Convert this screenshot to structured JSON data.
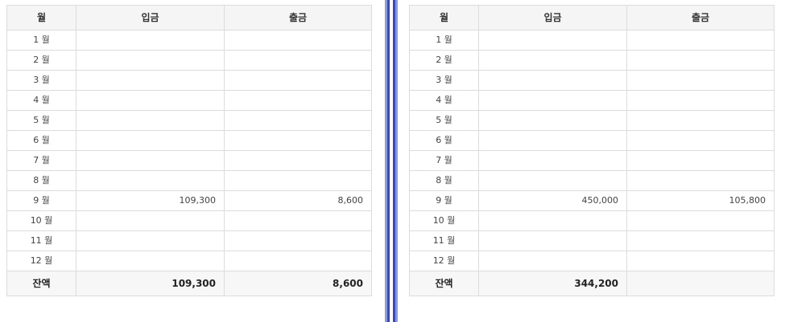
{
  "tables": [
    {
      "headers": [
        "월",
        "입금",
        "출금"
      ],
      "rows": [
        {
          "month": "1 월",
          "deposit": "",
          "withdrawal": ""
        },
        {
          "month": "2 월",
          "deposit": "",
          "withdrawal": ""
        },
        {
          "month": "3 월",
          "deposit": "",
          "withdrawal": ""
        },
        {
          "month": "4 월",
          "deposit": "",
          "withdrawal": ""
        },
        {
          "month": "5 월",
          "deposit": "",
          "withdrawal": ""
        },
        {
          "month": "6 월",
          "deposit": "",
          "withdrawal": ""
        },
        {
          "month": "7 월",
          "deposit": "",
          "withdrawal": ""
        },
        {
          "month": "8 월",
          "deposit": "",
          "withdrawal": ""
        },
        {
          "month": "9 월",
          "deposit": "109,300",
          "withdrawal": "8,600"
        },
        {
          "month": "10 월",
          "deposit": "",
          "withdrawal": ""
        },
        {
          "month": "11 월",
          "deposit": "",
          "withdrawal": ""
        },
        {
          "month": "12 월",
          "deposit": "",
          "withdrawal": ""
        }
      ],
      "balance": {
        "label": "잔액",
        "deposit": "109,300",
        "withdrawal": "8,600"
      }
    },
    {
      "headers": [
        "월",
        "입금",
        "출금"
      ],
      "rows": [
        {
          "month": "1 월",
          "deposit": "",
          "withdrawal": ""
        },
        {
          "month": "2 월",
          "deposit": "",
          "withdrawal": ""
        },
        {
          "month": "3 월",
          "deposit": "",
          "withdrawal": ""
        },
        {
          "month": "4 월",
          "deposit": "",
          "withdrawal": ""
        },
        {
          "month": "5 월",
          "deposit": "",
          "withdrawal": ""
        },
        {
          "month": "6 월",
          "deposit": "",
          "withdrawal": ""
        },
        {
          "month": "7 월",
          "deposit": "",
          "withdrawal": ""
        },
        {
          "month": "8 월",
          "deposit": "",
          "withdrawal": ""
        },
        {
          "month": "9 월",
          "deposit": "450,000",
          "withdrawal": "105,800"
        },
        {
          "month": "10 월",
          "deposit": "",
          "withdrawal": ""
        },
        {
          "month": "11 월",
          "deposit": "",
          "withdrawal": ""
        },
        {
          "month": "12 월",
          "deposit": "",
          "withdrawal": ""
        }
      ],
      "balance": {
        "label": "잔액",
        "deposit": "344,200",
        "withdrawal": ""
      }
    }
  ],
  "colors": {
    "divider_outer": "#8b9bd8",
    "divider_inner": "#3a4ab8",
    "header_bg": "#f5f5f5",
    "border": "#dcdcdc"
  }
}
